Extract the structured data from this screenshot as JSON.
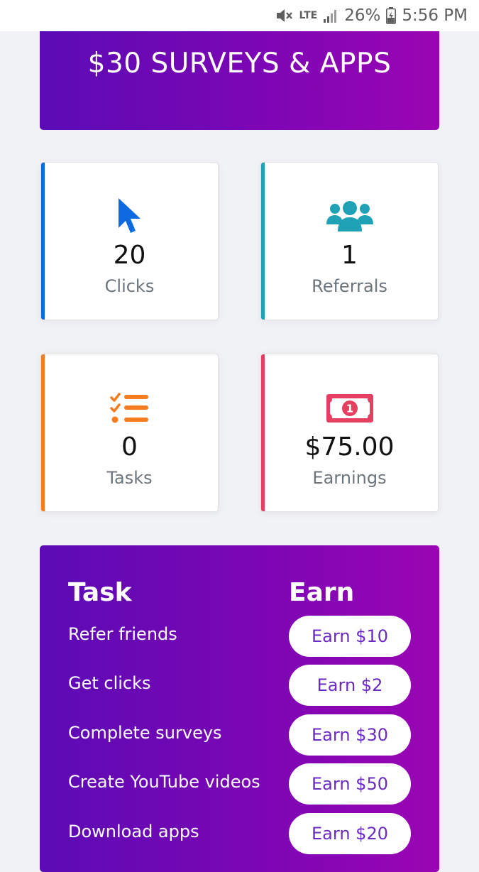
{
  "status_bar": {
    "network": "LTE",
    "battery": "26%",
    "time": "5:56 PM"
  },
  "banner": {
    "title": "$30 SURVEYS & APPS"
  },
  "stats": [
    {
      "value": "20",
      "label": "Clicks",
      "icon": "cursor-icon",
      "color": "#0d6ae0"
    },
    {
      "value": "1",
      "label": "Referrals",
      "icon": "users-icon",
      "color": "#1fa2b6"
    },
    {
      "value": "0",
      "label": "Tasks",
      "icon": "task-list-icon",
      "color": "#f57c1f"
    },
    {
      "value": "$75.00",
      "label": "Earnings",
      "icon": "money-bill-icon",
      "color": "#e63f62"
    }
  ],
  "tasks": {
    "header_task": "Task",
    "header_earn": "Earn",
    "rows": [
      {
        "name": "Refer friends",
        "earn": "Earn $10"
      },
      {
        "name": "Get clicks",
        "earn": "Earn $2"
      },
      {
        "name": "Complete surveys",
        "earn": "Earn $30"
      },
      {
        "name": "Create YouTube videos",
        "earn": "Earn $50"
      },
      {
        "name": "Download apps",
        "earn": "Earn $20"
      }
    ]
  }
}
